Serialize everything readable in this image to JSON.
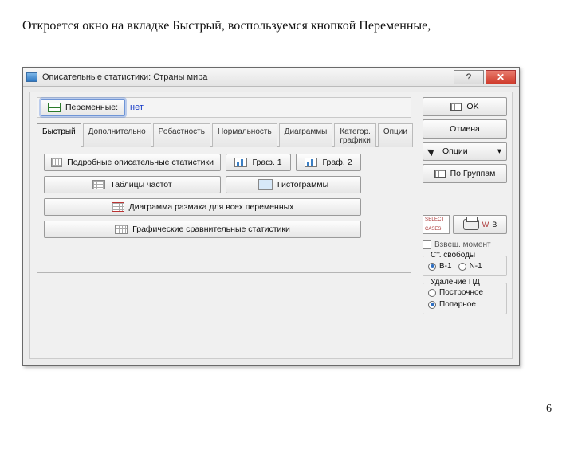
{
  "caption": "Откроется окно на вкладке Быстрый, воспользуемся кнопкой Переменные,",
  "page_number": "6",
  "window": {
    "title": "Описательные статистики: Страны мира"
  },
  "vars": {
    "button": "Переменные:",
    "none": "нет"
  },
  "tabs": {
    "t0": "Быстрый",
    "t1": "Дополнительно",
    "t2": "Робастность",
    "t3": "Нормальность",
    "t4": "Диаграммы",
    "t5": "Категор. графики",
    "t6": "Опции"
  },
  "buttons": {
    "detailed": "Подробные описательные статистики",
    "graph1": "Граф. 1",
    "graph2": "Граф. 2",
    "freq": "Таблицы частот",
    "hist": "Гистограммы",
    "box": "Диаграмма размаха для всех переменных",
    "compare": "Графические сравнительные статистики"
  },
  "right": {
    "ok": "OK",
    "cancel": "Отмена",
    "options": "Опции",
    "bygroup": "По Группам",
    "wgt": "Взвеш. момент",
    "df_legend": "Ст. свободы",
    "df_b1": "В-1",
    "df_n1": "N-1",
    "del_legend": "Удаление ПД",
    "del_row": "Построчное",
    "del_pair": "Попарное",
    "badge_w": "W",
    "badge_b": "В"
  }
}
